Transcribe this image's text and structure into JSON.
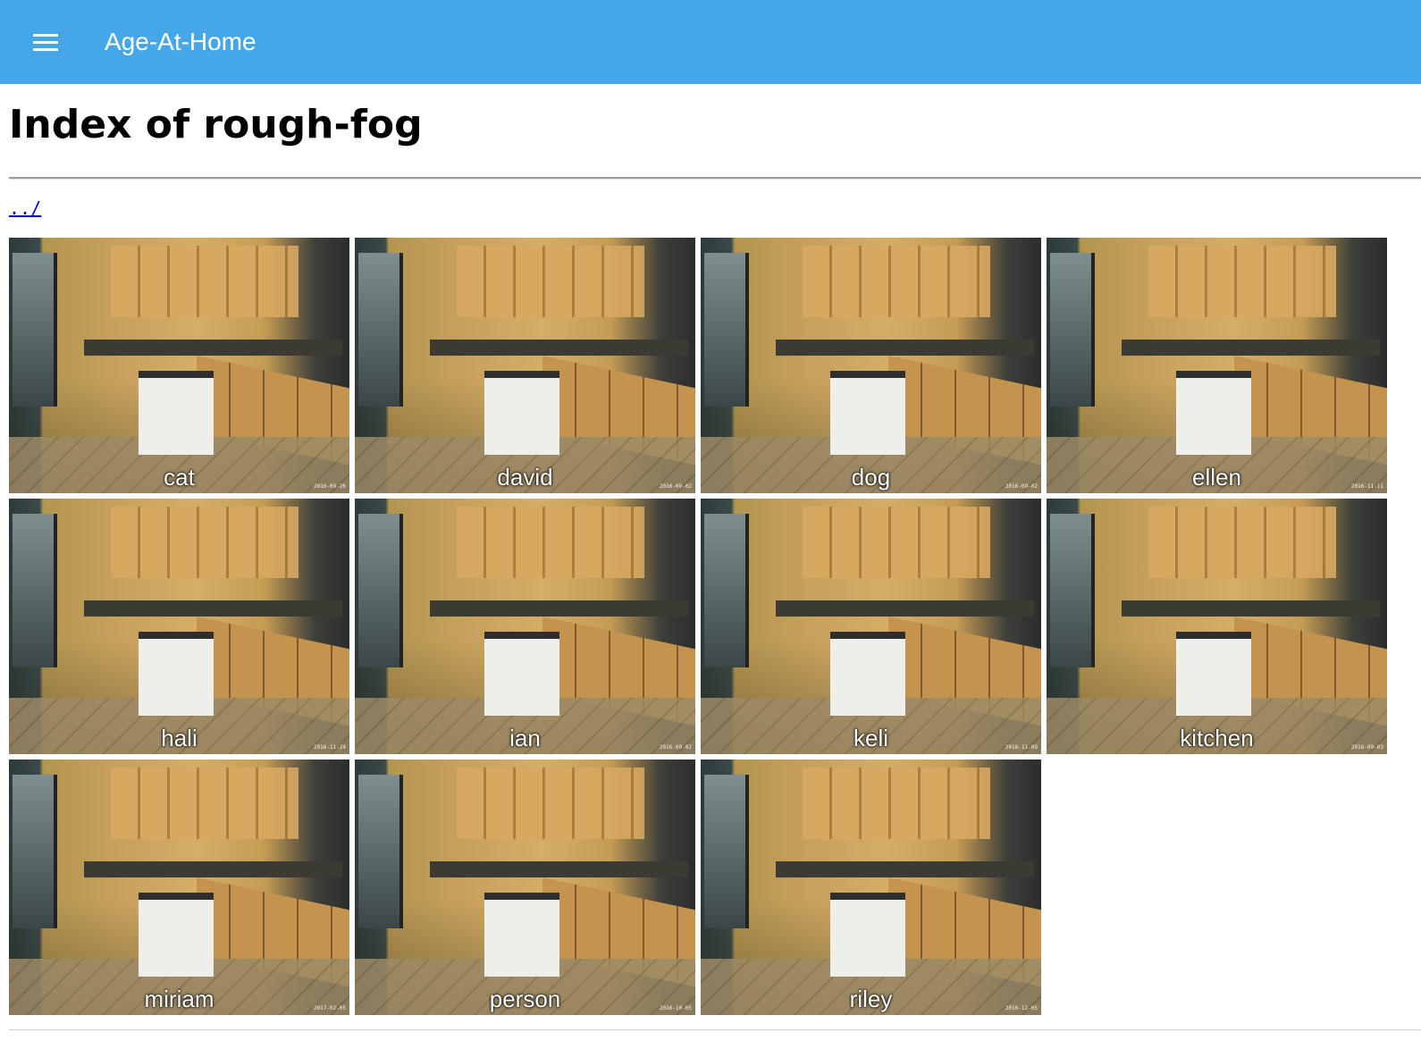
{
  "appbar": {
    "title": "Age-At-Home",
    "menu_icon": "hamburger-menu-icon",
    "color": "#45a6e8"
  },
  "page": {
    "heading": "Index of rough-fog",
    "parent_link": "../"
  },
  "tiles": [
    {
      "label": "cat",
      "stamp": "2016-09-26"
    },
    {
      "label": "david",
      "stamp": "2016-09-02"
    },
    {
      "label": "dog",
      "stamp": "2016-09-02"
    },
    {
      "label": "ellen",
      "stamp": "2016-11-11"
    },
    {
      "label": "hali",
      "stamp": "2016-11-24"
    },
    {
      "label": "ian",
      "stamp": "2016-09-02"
    },
    {
      "label": "keli",
      "stamp": "2016-11-09"
    },
    {
      "label": "kitchen",
      "stamp": "2016-09-03"
    },
    {
      "label": "miriam",
      "stamp": "2017-02-05"
    },
    {
      "label": "person",
      "stamp": "2016-10-05"
    },
    {
      "label": "riley",
      "stamp": "2016-11-05"
    }
  ]
}
